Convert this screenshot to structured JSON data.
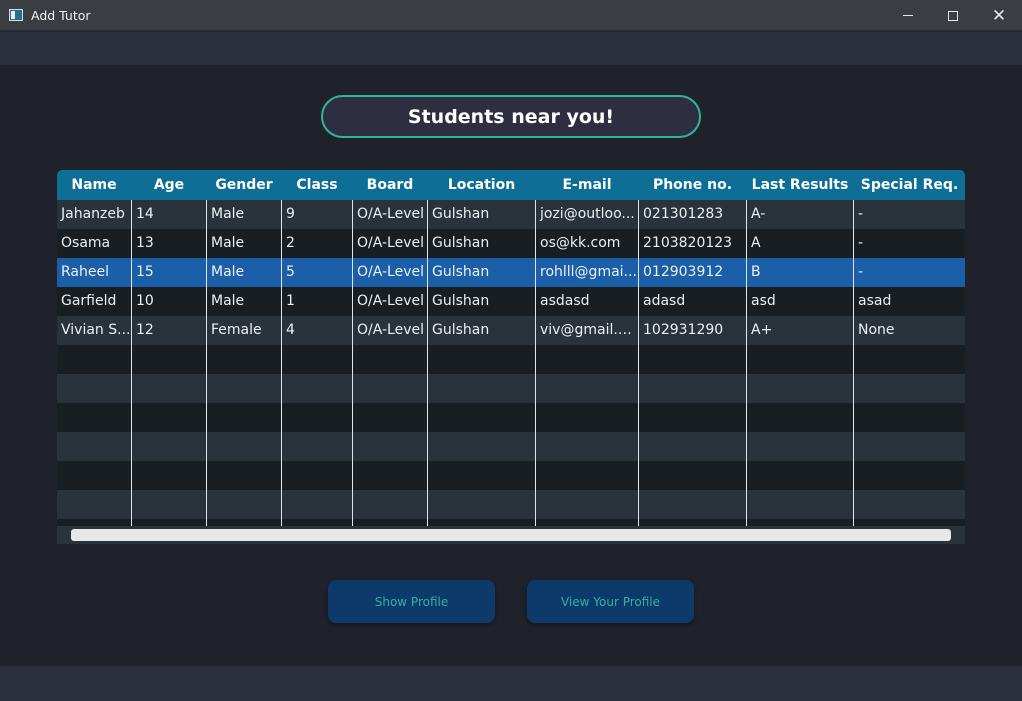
{
  "window": {
    "title": "Add Tutor"
  },
  "heading": "Students near you!",
  "table": {
    "columns": [
      "Name",
      "Age",
      "Gender",
      "Class",
      "Board",
      "Location",
      "E-mail",
      "Phone no.",
      "Last Results",
      "Special Req."
    ],
    "rows": [
      [
        "Jahanzeb",
        "14",
        "Male",
        "9",
        "O/A-Level",
        "Gulshan",
        "jozi@outloo...",
        "021301283",
        "A-",
        "-"
      ],
      [
        "Osama",
        "13",
        "Male",
        "2",
        "O/A-Level",
        "Gulshan",
        "os@kk.com",
        "2103820123",
        "A",
        "-"
      ],
      [
        "Raheel",
        "15",
        "Male",
        "5",
        "O/A-Level",
        "Gulshan",
        "rohlll@gmai...",
        "012903912",
        "B",
        "-"
      ],
      [
        "Garfield",
        "10",
        "Male",
        "1",
        "O/A-Level",
        "Gulshan",
        "asdasd",
        "adasd",
        "asd",
        "asad"
      ],
      [
        "Vivian S...",
        "12",
        "Female",
        "4",
        "O/A-Level",
        "Gulshan",
        "viv@gmail.c...",
        "102931290",
        "A+",
        "None"
      ]
    ],
    "selected_row": 2
  },
  "buttons": {
    "show_profile": "Show Profile",
    "view_your_profile": "View Your Profile"
  },
  "colors": {
    "header": "#0f6e96",
    "selected_row": "#1a5fa8",
    "accent": "#30b49a",
    "button_bg": "#0d3a6a"
  }
}
